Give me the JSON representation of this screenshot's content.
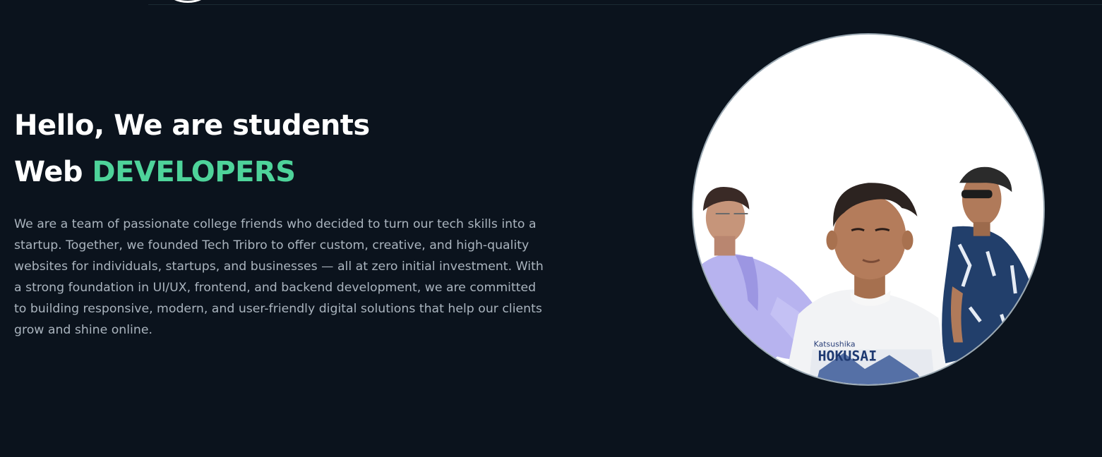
{
  "hero": {
    "title_line1": "Hello, We are students",
    "title_line2_plain": "Web ",
    "title_line2_accent": "DEVELOPERS",
    "description": "We are a team of passionate college friends who decided to turn our tech skills into a startup. Together, we founded Tech Tribro to offer custom, creative, and high-quality websites for individuals, startups, and businesses — all at zero initial investment. With a strong foundation in UI/UX, frontend, and backend development, we are committed to building responsive, modern, and user-friendly digital solutions that help our clients grow and shine online."
  },
  "photo": {
    "shirt_print_text": "HOKUSAI",
    "shirt_print_small": "Katsushika"
  },
  "colors": {
    "background": "#0b131d",
    "accent": "#4ed39a",
    "title": "#ffffff",
    "body_text": "#aab4be"
  }
}
